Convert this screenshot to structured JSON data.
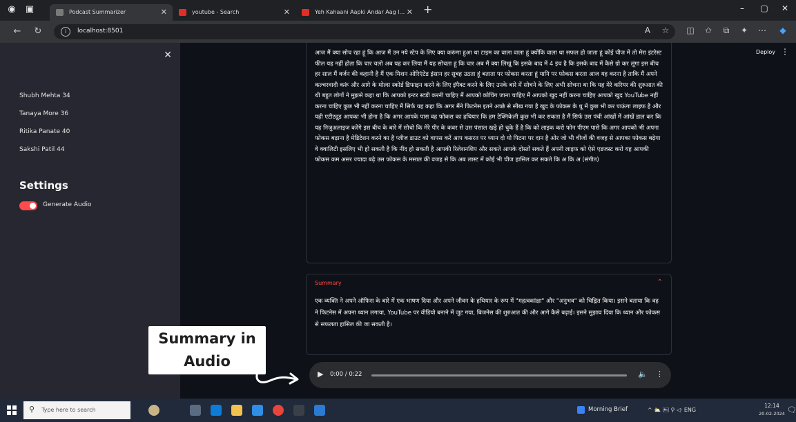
{
  "colors": {
    "accent": "#ff4b4b",
    "sidebar_bg": "#262730",
    "main_bg": "#0e1117",
    "browser_chrome": "#202124"
  },
  "browser": {
    "tabs": [
      {
        "title": "Podcast Summarizer",
        "favicon": "app-favicon",
        "active": true
      },
      {
        "title": "youtube - Search",
        "favicon": "youtube-favicon",
        "active": false
      },
      {
        "title": "Yeh Kahaani Aapki Andar Aag l...",
        "favicon": "youtube-favicon",
        "active": false
      }
    ],
    "url": "localhost:8501",
    "window_controls": {
      "minimize": "–",
      "maximize": "▢",
      "close": "✕"
    }
  },
  "sidebar": {
    "close_label": "✕",
    "members": [
      "Shubh Mehta 34",
      "Tanaya More 36",
      "Ritika Panate 40",
      "Sakshi Patil 44"
    ],
    "settings_title": "Settings",
    "toggle_label": "Generate Audio",
    "toggle_on": true
  },
  "header": {
    "deploy_label": "Deploy",
    "menu_label": "⋮"
  },
  "transcript": {
    "text": "आज मैं क्या सोच रहा हूं कि आज मैं उन नये स्टेप के लिए क्या करूंगा हुआ था टाइम का वाला वाला हूं क्योंकि वाला था सफल हो जाता हूं कोई चीज में तो मेरा इंटरेस्ट फील यह नहीं होता कि चार चलो अब यह कर लिया मैं यह सोचता हूं कि चार अब मैं क्या लिखूं कि इसके बाद में 4 इंच है कि इसके बाद में कैसे ग्रो कर लूंगा इस बीच हर साल मैं वर्जन की कहानी है मैं एक मिशन ओरिएंटेड इंसान हर सुबह उठता हूं बताता पर फोकस करता हूं यानि पर फोकस करता आज यह करना है ताकि मैं अपने कल्चरवादी करूं और आगे के मोल्स स्कोर्ड डिफाइन करने के लिए इंपैक्ट करने के लिए उनके बारे में सोचने के लिए अभी सोचना था कि यह मेरे करियर की शुरुआत की थी बहुत लोगों ने मुझसे कहा था कि आपको इन्टर स्टडी करनी चाहिए मैं आपको कोचिंग जाना चाहिए मैं आपको खुद नहीं करना चाहिए आपको खुद YouTube नहीं करना चाहिए कुछ भी नहीं करना चाहिए मैं सिर्फ यह कहा कि अगर मैंने फिटनेस इतने अच्छे से सीख गया है खुद के फोकस के धू में कुछ भी कर पाऊंगा लाइफ है और यही एटीट्यूड आपका भी होना है कि अगर आपके पास वह फोकस का हथियार कि हम टेक्निकेली कुछ भी कर सकता है मैं सिर्फ उस पंची आंखों में आंखें डाल कर कि यह निजुअलाइज करेंगे इस बीच के बारे में सोचो कि मेरे पीर के कवर से उस पंसाल खड़े हो चुके हैं है कि को लाइक करो फोन पीएम पासे कि अगर आपको भी अपना फोकस बढ़ाना है मेडिटेशन करने का है प्लीज डाउट को वापस करें आप कसरत पर ध्यान दो यो पिटना पर दान है ओर जो भी चीजों की वजह से आपका फोकस बढ़ेगा वे क्वालिटी इसलिए भी हो सकती है कि नींद हो सकती है आपकी रिलेशनशिप और सकते आपके दोस्तों सकते हैं अपनी लाइफ को ऐसे एडजस्ट करो यह आपकी फोकस कम असर ज्यादा बढ़े उस फोकस के मसाल की वजह से कि अब लास्ट में कोई भी चीज हासिल कर सकते कि अ कि अ (संगीत)"
  },
  "summary": {
    "title": "Summary",
    "text": "एक व्यक्ति ने अपने ऑफिस के बारे में एक भाषण दिया और अपने जीवन के हथियार के रूप में \"महत्वकांक्षा\" और \"अनुभव\" को चिह्नित किया। इसने बताया कि वह ने फिटनेस में अपना ध्यान लगाया, YouTube पर वीडियो बनाने में जुट गया, बिजनेस की शुरुआत की और आगे कैसे बढ़ाई। इसने सुझाव दिया कि ध्यान और फोकस से सफलता हासिल की जा सकती है।"
  },
  "annotation": {
    "text": "Summary in Audio"
  },
  "audio_player": {
    "time": "0:00 / 0:22",
    "progress": 0
  },
  "taskbar": {
    "search_placeholder": "Type here to search",
    "news": "Morning Brief",
    "tray": "^ ⛅ 🖭 ⚲ ◁ᐧ ENG",
    "time": "12:14",
    "date": "20-02-2024"
  }
}
